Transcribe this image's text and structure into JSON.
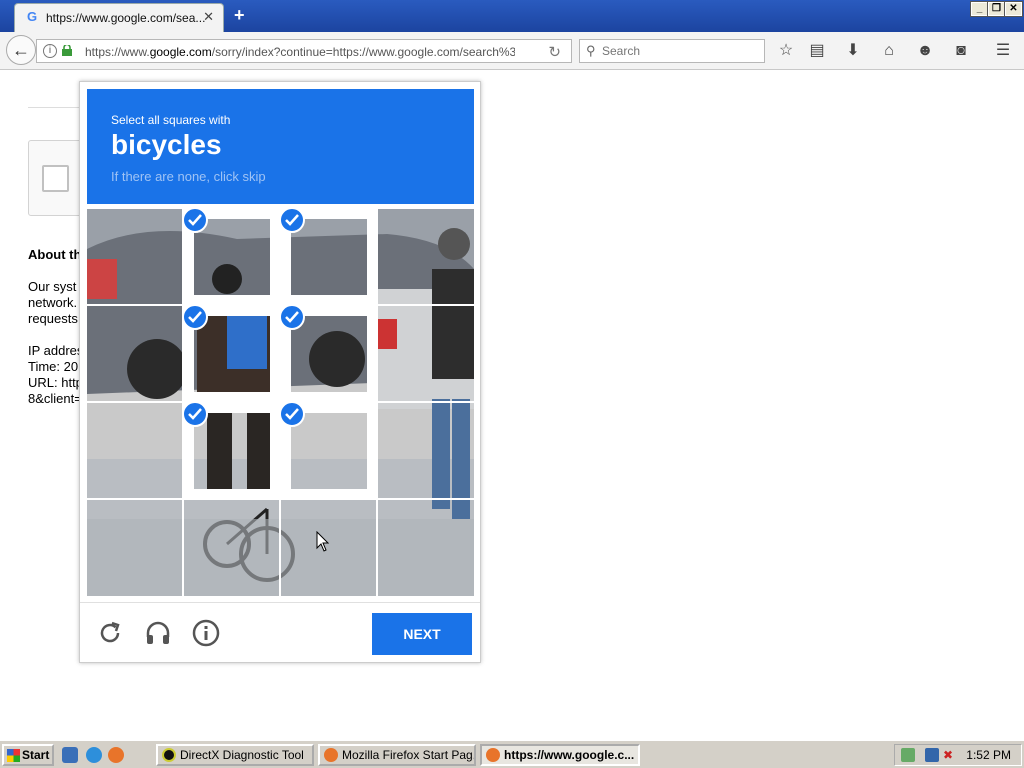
{
  "browser": {
    "tab_title": "https://www.google.com/sea...",
    "tab_favicon": "G",
    "url_prefix": "https://www.",
    "url_domain": "google.com",
    "url_rest": "/sorry/index?continue=https://www.google.com/search%3Fq%",
    "search_placeholder": "Search"
  },
  "page": {
    "about_heading": "About th",
    "lines": [
      "Our syst",
      "network.",
      "requests",
      "IP addres",
      "Time: 20",
      "URL: http",
      "8&client="
    ]
  },
  "captcha": {
    "instruction": "Select all squares with",
    "target": "bicycles",
    "hint": "If there are none, click skip",
    "next_label": "NEXT",
    "selected_tiles": [
      1,
      2,
      5,
      6,
      9,
      10
    ],
    "accent_color": "#1a73e8"
  },
  "taskbar": {
    "start_label": "Start",
    "tasks": [
      {
        "label": "DirectX Diagnostic Tool",
        "active": false
      },
      {
        "label": "Mozilla Firefox Start Pag...",
        "active": false
      },
      {
        "label": "https://www.google.c...",
        "active": true
      }
    ],
    "clock": "1:52 PM"
  }
}
